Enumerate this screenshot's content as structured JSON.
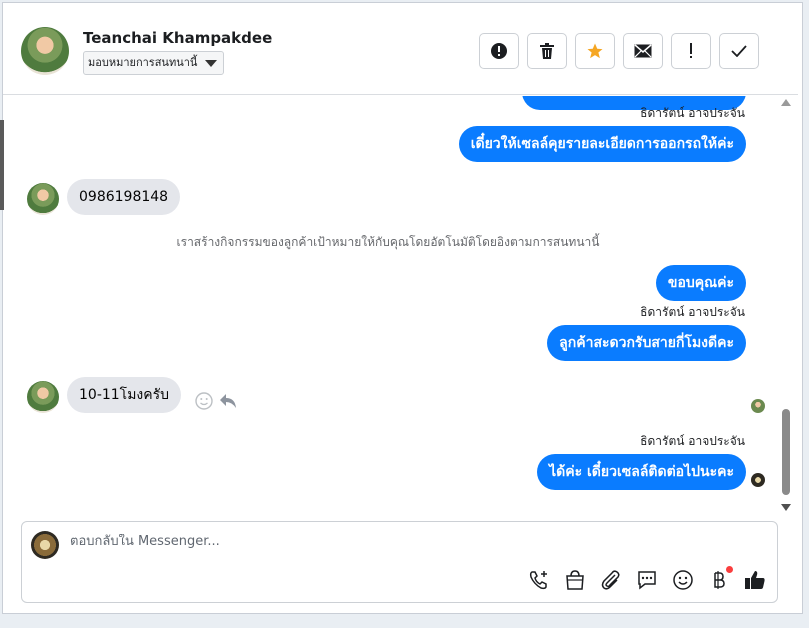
{
  "header": {
    "contact_name": "Teanchai Khampakdee",
    "assign_label": "มอบหมายการสนทนานี้",
    "actions": [
      {
        "icon": "alert-circle-icon",
        "label": "!"
      },
      {
        "icon": "trash-icon"
      },
      {
        "icon": "star-icon"
      },
      {
        "icon": "envelope-icon"
      },
      {
        "icon": "exclamation-icon",
        "label": "!"
      },
      {
        "icon": "check-icon",
        "label": "✓"
      }
    ]
  },
  "thread": {
    "messages": [
      {
        "from": "agent",
        "sender": "ธิดารัตน์ อาจประจัน",
        "text": ""
      },
      {
        "from": "agent",
        "text": "เดี๋ยวให้เซลล์คุยรายละเอียดการออกรถให้ค่ะ"
      },
      {
        "from": "customer",
        "text": "0986198148"
      },
      {
        "from": "system",
        "text": "เราสร้างกิจกรรมของลูกค้าเป้าหมายให้กับคุณโดยอัตโนมัติโดยอิงตามการสนทนานี้"
      },
      {
        "from": "agent",
        "text": "ขอบคุณค่ะ"
      },
      {
        "from": "agent",
        "sender": "ธิดารัตน์ อาจประจัน",
        "text": "ลูกค้าสะดวกรับสายกี่โมงดีคะ"
      },
      {
        "from": "customer",
        "text": "10-11โมงครับ"
      },
      {
        "from": "agent",
        "sender": "ธิดารัตน์ อาจประจัน",
        "text": "ได้ค่ะ เดี๋ยวเซลล์ติดต่อไปนะคะ"
      }
    ],
    "colors": {
      "outgoing": "#0a7cff",
      "incoming": "#e4e6eb",
      "star": "#f5a623"
    }
  },
  "composer": {
    "placeholder": "ตอบกลับใน Messenger...",
    "tools": [
      "phone-plus-icon",
      "shopping-bag-icon",
      "paperclip-icon",
      "chat-bubble-icon",
      "smiley-icon",
      "baht-icon",
      "thumbs-up-icon"
    ]
  }
}
